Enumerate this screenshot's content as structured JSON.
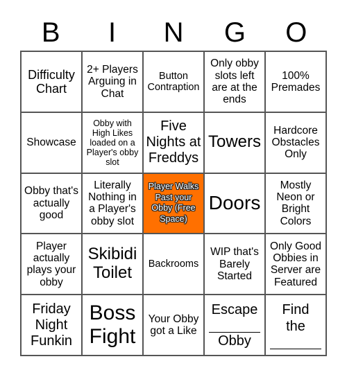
{
  "header": {
    "letters": [
      "B",
      "I",
      "N",
      "G",
      "O"
    ]
  },
  "colors": {
    "free_space_bg": "#ff7000",
    "grid_line": "#555555",
    "cell_bg": "#ffffff"
  },
  "cells": [
    [
      "Difficulty Chart",
      "2+ Players Arguing in Chat",
      "Button Contraption",
      "Only obby slots left are at the ends",
      "100% Premades"
    ],
    [
      "Showcase",
      "Obby with High Likes loaded on a Player's obby slot",
      "Five Nights at Freddys",
      "Towers",
      "Hardcore Obstacles Only"
    ],
    [
      "Obby that's actually good",
      "Literally Nothing in a Player's obby slot",
      "Player Walks Past your Obby (Free Space)",
      "Doors",
      "Mostly Neon or Bright Colors"
    ],
    [
      "Player actually plays your obby",
      "Skibidi Toilet",
      "Backrooms",
      "WIP that's Barely Started",
      "Only Good Obbies in Server are Featured"
    ],
    [
      "Friday Night Funkin",
      "Boss Fight",
      "Your Obby got a Like",
      {
        "top": "Escape",
        "bottom": "Obby"
      },
      {
        "top": "Find the"
      }
    ]
  ],
  "free_space": {
    "row": 2,
    "col": 2,
    "label": "Player Walks Past your Obby (Free Space)"
  }
}
